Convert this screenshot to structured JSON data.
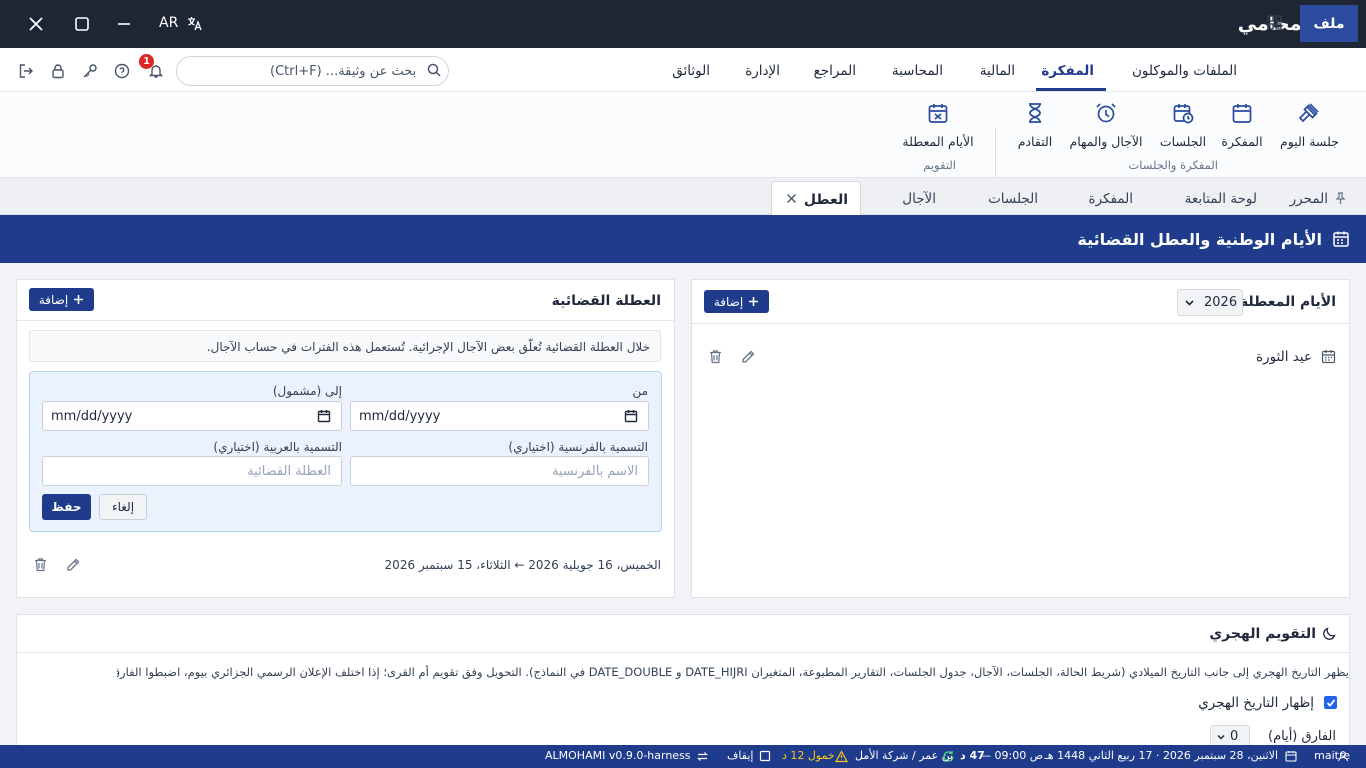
{
  "titlebar": {
    "lang": "AR",
    "app_name": "المحامي"
  },
  "menubar": {
    "file_label": "ملف",
    "items": [
      "الملفات والموكلون",
      "المفكرة",
      "المالية",
      "المحاسبة",
      "المراجع",
      "الإدارة",
      "الوثائق"
    ],
    "active": "المفكرة",
    "search_placeholder": "بحث عن وثيقة... (Ctrl+F)",
    "notification_count": "1"
  },
  "ribbon": {
    "buttons": [
      "جلسة اليوم",
      "المفكرة",
      "الجلسات",
      "الآجال والمهام",
      "التقادم",
      "الأيام المعطلة"
    ],
    "groups": [
      "المفكرة والجلسات",
      "التقويم"
    ]
  },
  "tabs": {
    "items": [
      "المحرر",
      "لوحة المتابعة",
      "المفكرة",
      "الجلسات",
      "الآجال"
    ],
    "active": "العطل"
  },
  "page": {
    "title": "الأيام الوطنية والعطل القضائية"
  },
  "holidays_panel": {
    "title": "الأيام المعطلة",
    "year": "2026",
    "add_label": "إضافة",
    "items": [
      {
        "name": "عيد الثورة"
      }
    ]
  },
  "judicial_panel": {
    "title": "العطلة القضائية",
    "add_label": "إضافة",
    "info": "خلال العطلة القضائية تُعلّق بعض الآجال الإجرائية. تُستعمل هذه الفترات في حساب الآجال.",
    "form": {
      "from_label": "من",
      "to_label": "إلى (مشمول)",
      "from_value": "mm/dd/yyyy",
      "to_value": "mm/dd/yyyy",
      "fr_label": "التسمية بالفرنسية (اختياري)",
      "ar_label": "التسمية بالعربية (اختياري)",
      "fr_placeholder": "الاسم بالفرنسية",
      "ar_placeholder": "العطلة القضائية",
      "save_label": "حفظ",
      "cancel_label": "إلغاء"
    },
    "range": "الخميس، 16 جويلية 2026 ← الثلاثاء، 15 سبتمبر 2026"
  },
  "hijri": {
    "title": "التقويم الهجري",
    "description": "يظهر التاريخ الهجري إلى جانب التاريخ الميلادي (شريط الحالة، الجلسات، الآجال، جدول الجلسات، التقارير المطبوعة، المتغيران DATE_HIJRI و DATE_DOUBLE في النماذج). التحويل وفق تقويم أم القرى؛ إذا اختلف الإعلان الرسمي الجزائري بيوم، اضبطوا الفارق.",
    "show_label": "إظهار التاريخ الهجري",
    "show_checked": true,
    "offset_label": "الفارق (أيام)",
    "offset_value": "0"
  },
  "status": {
    "user": "maitre",
    "date": "الاثنين، 28 سبتمبر 2026 · 17 ربيع الثاني 1448 هـ",
    "time": "— 09:00 ص",
    "count": "47 د",
    "lawyer": "بن عمر / شركة الأمل",
    "dormant": "خمول 12 د",
    "stop": "إيقاف",
    "version": "ALMOHAMI v0.9.0-harness"
  },
  "colors": {
    "primary": "#1f3b8c",
    "titlebar": "#1f2633",
    "file_button": "#2b4c9e",
    "form_bg": "#eaf2fd",
    "badge": "#dc2626"
  }
}
